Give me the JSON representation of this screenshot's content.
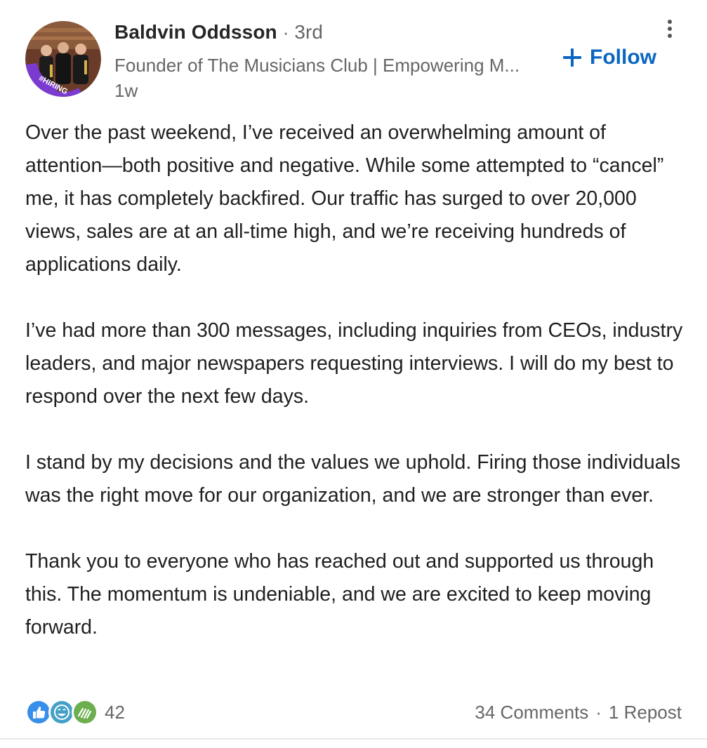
{
  "author": {
    "name": "Baldvin Oddsson",
    "separator": "·",
    "degree": "3rd",
    "headline": "Founder of The Musicians Club | Empowering M...",
    "time": "1w",
    "avatar_badge": "#HIRING"
  },
  "actions": {
    "follow_label": "Follow",
    "more_icon": "more-vertical-icon"
  },
  "post": {
    "paragraphs": [
      "Over the past weekend, I’ve received an overwhelming amount of attention—both positive and negative. While some attempted to “cancel” me, it has completely backfired. Our traffic has surged to over 20,000 views, sales are at an all-time high, and we’re receiving hundreds of applications daily.",
      "I’ve had more than 300 messages, including inquiries from CEOs, industry leaders, and major newspapers requesting interviews. I will do my best to respond over the next few days.",
      "I stand by my decisions and the values we uphold. Firing those individuals was the right move for our organization, and we are stronger than ever.",
      "Thank you to everyone who has reached out and supported us through this. The momentum is undeniable, and we are excited to keep moving forward."
    ]
  },
  "social": {
    "reaction_icons": [
      "like-icon",
      "funny-icon",
      "support-icon"
    ],
    "reaction_count": "42",
    "comments": "34 Comments",
    "separator": "·",
    "reposts": "1 Repost"
  },
  "colors": {
    "accent": "#0a66c2",
    "secondary_text": "#666666",
    "like": "#378fe9",
    "funny": "#44a0c7",
    "support": "#6dae4f",
    "hiring_frame": "#7c3bd0"
  }
}
